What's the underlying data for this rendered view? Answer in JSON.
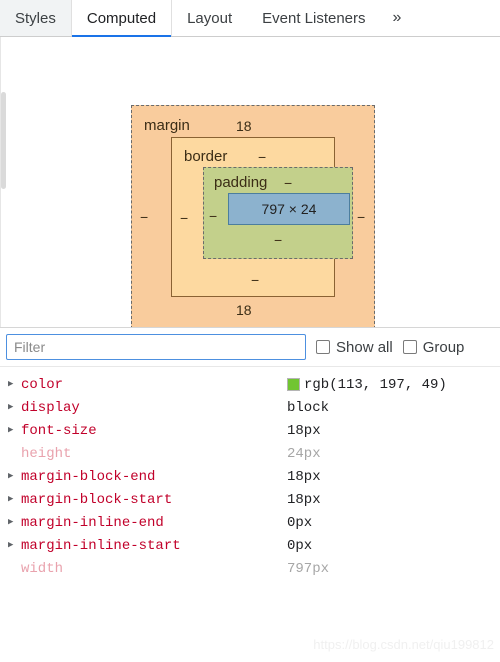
{
  "tabs": [
    {
      "label": "Styles",
      "active": false
    },
    {
      "label": "Computed",
      "active": true
    },
    {
      "label": "Layout",
      "active": false
    },
    {
      "label": "Event Listeners",
      "active": false
    }
  ],
  "more_tabs_icon": "»",
  "box_model": {
    "margin": {
      "label": "margin",
      "top": "18",
      "right": "−",
      "bottom": "18",
      "left": "−"
    },
    "border": {
      "label": "border",
      "top": "−",
      "right": "−",
      "bottom": "−",
      "left": "−"
    },
    "padding": {
      "label": "padding",
      "top": "−",
      "right": "−",
      "bottom": "−",
      "left": "−"
    },
    "content": {
      "label": "797 × 24",
      "width": "797",
      "height": "24"
    },
    "colors": {
      "margin": "#f9cc9d",
      "border": "#fdd9a0",
      "padding": "#c3d08b",
      "content": "#8cb2ce"
    }
  },
  "filter": {
    "placeholder": "Filter",
    "value": "",
    "show_all_label": "Show all",
    "show_all_checked": false,
    "group_label": "Group",
    "group_checked": false
  },
  "properties": [
    {
      "name": "color",
      "value": "rgb(113, 197, 49)",
      "expandable": true,
      "dim": false,
      "swatch": "#71c531"
    },
    {
      "name": "display",
      "value": "block",
      "expandable": true,
      "dim": false,
      "swatch": null
    },
    {
      "name": "font-size",
      "value": "18px",
      "expandable": true,
      "dim": false,
      "swatch": null
    },
    {
      "name": "height",
      "value": "24px",
      "expandable": false,
      "dim": true,
      "swatch": null
    },
    {
      "name": "margin-block-end",
      "value": "18px",
      "expandable": true,
      "dim": false,
      "swatch": null
    },
    {
      "name": "margin-block-start",
      "value": "18px",
      "expandable": true,
      "dim": false,
      "swatch": null
    },
    {
      "name": "margin-inline-end",
      "value": "0px",
      "expandable": true,
      "dim": false,
      "swatch": null
    },
    {
      "name": "margin-inline-start",
      "value": "0px",
      "expandable": true,
      "dim": false,
      "swatch": null
    },
    {
      "name": "width",
      "value": "797px",
      "expandable": false,
      "dim": true,
      "swatch": null
    }
  ],
  "watermark": "https://blog.csdn.net/qiu199812"
}
